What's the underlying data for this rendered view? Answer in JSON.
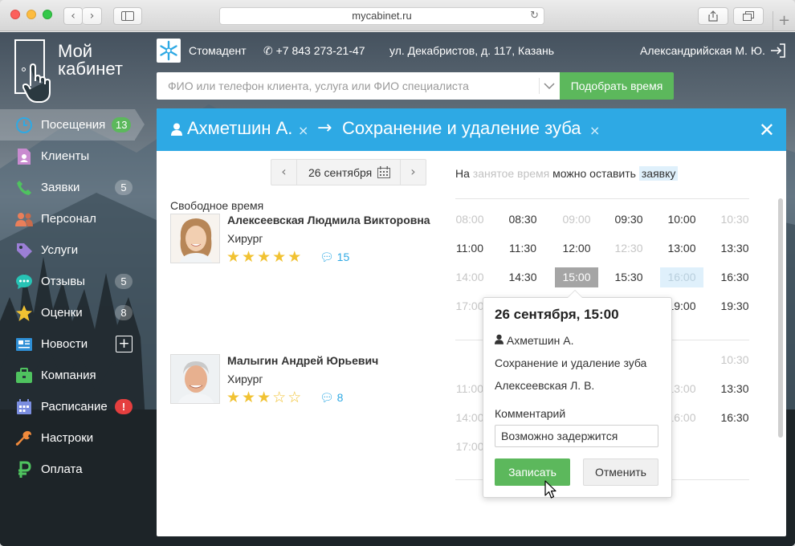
{
  "browser": {
    "url": "mycabinet.ru",
    "back_glyph": "‹",
    "forward_glyph": "›",
    "new_tab_glyph": "+"
  },
  "app": {
    "logo_line1": "Мой",
    "logo_line2": "кабинет"
  },
  "sidebar": {
    "items": [
      {
        "label": "Посещения",
        "icon": "clock-icon",
        "badge": "13"
      },
      {
        "label": "Клиенты",
        "icon": "document-user-icon",
        "badge": ""
      },
      {
        "label": "Заявки",
        "icon": "phone-icon",
        "badge": "5"
      },
      {
        "label": "Персонал",
        "icon": "people-icon",
        "badge": ""
      },
      {
        "label": "Услуги",
        "icon": "tag-icon",
        "badge": ""
      },
      {
        "label": "Отзывы",
        "icon": "chat-bubble-icon",
        "badge": "5"
      },
      {
        "label": "Оценки",
        "icon": "star-icon",
        "badge": "8"
      },
      {
        "label": "Новости",
        "icon": "newspaper-icon",
        "badge": "+"
      },
      {
        "label": "Компания",
        "icon": "briefcase-icon",
        "badge": ""
      },
      {
        "label": "Расписание",
        "icon": "calendar-icon",
        "badge": "!"
      },
      {
        "label": "Настроки",
        "icon": "wrench-icon",
        "badge": ""
      },
      {
        "label": "Оплата",
        "icon": "ruble-icon",
        "badge": ""
      }
    ]
  },
  "header": {
    "clinic": "Стомадент",
    "phone": "+7 843 273-21-47",
    "address": "ул. Декабристов, д. 117, Казань",
    "user": "Александрийская М. Ю."
  },
  "search": {
    "placeholder": "ФИО или телефон клиента, услуга или ФИО специалиста",
    "button": "Подобрать время"
  },
  "booking": {
    "client": "Ахметшин А.",
    "arrow": "→",
    "service": "Сохранение и удаление зуба",
    "remove_glyph": "×",
    "close_glyph": "✕",
    "free_time_label": "Свободное время",
    "date": "26 сентября",
    "legend_prefix": "На",
    "legend_taken": "занятое время",
    "legend_mid": "можно оставить",
    "legend_request": "заявку"
  },
  "doctors": [
    {
      "name": "Алексеевская Людмила Викторовна",
      "specialty": "Хирург",
      "rating": 5,
      "reviews": "15"
    },
    {
      "name": "Малыгин Андрей Юрьевич",
      "specialty": "Хирург",
      "rating": 3,
      "reviews": "8"
    }
  ],
  "slots_doctor1": [
    [
      "08:00",
      "08:30",
      "09:00",
      "09:30",
      "10:00",
      "10:30"
    ],
    [
      "11:00",
      "11:30",
      "12:00",
      "12:30",
      "13:00",
      "13:30"
    ],
    [
      "14:00",
      "14:30",
      "15:00",
      "15:30",
      "16:00",
      "16:30"
    ],
    [
      "17:00",
      "",
      "",
      "",
      "19:00",
      "19:30"
    ]
  ],
  "slots_doctor2": [
    [
      "",
      "",
      "",
      "",
      "",
      "10:30"
    ],
    [
      "11:00",
      "",
      "",
      "",
      "13:00",
      "13:30"
    ],
    [
      "14:00",
      "",
      "",
      "",
      "16:00",
      "16:30"
    ],
    [
      "17:00",
      "",
      "",
      "",
      "",
      ""
    ]
  ],
  "popup": {
    "title": "26 сентября, 15:00",
    "client": "Ахметшин А.",
    "service": "Сохранение и удаление зуба",
    "doctor": "Алексеевская Л. В.",
    "comment_label": "Комментарий",
    "comment_value": "Возможно задержится",
    "save": "Записать",
    "cancel": "Отменить"
  },
  "colors": {
    "accent_blue": "#2ea9e4",
    "green": "#5cb85c",
    "alert_red": "#e53f3f",
    "star": "#f1c232"
  }
}
